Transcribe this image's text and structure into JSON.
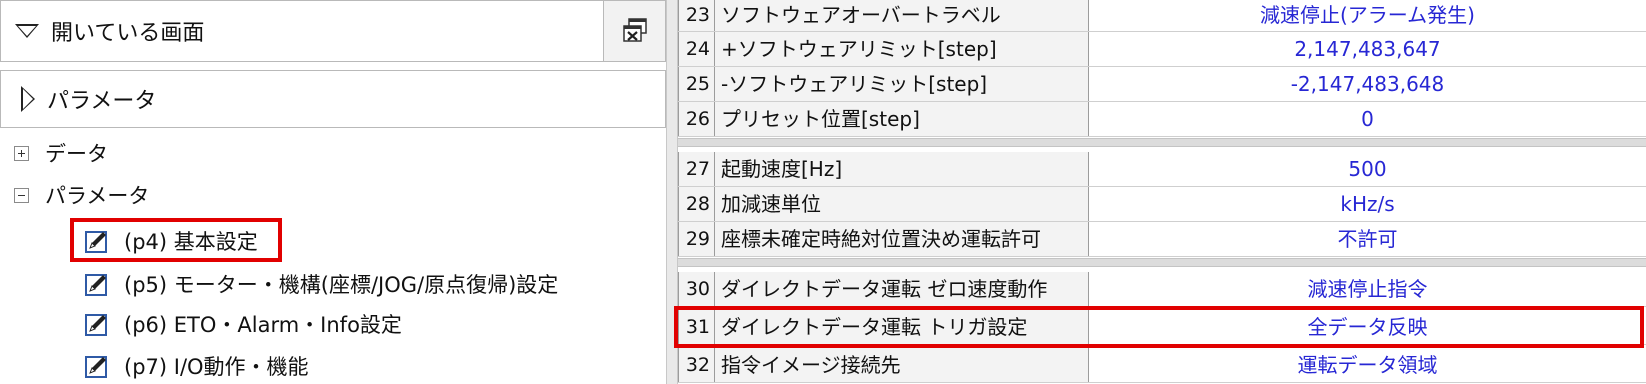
{
  "left_panel": {
    "open_screens_header": "開いている画面",
    "parameter_header": "パラメータ",
    "tree": [
      {
        "label": "データ",
        "expander": "plus"
      },
      {
        "label": "パラメータ",
        "expander": "minus"
      }
    ],
    "children": [
      {
        "label": "(p4) 基本設定",
        "highlighted": true
      },
      {
        "label": "(p5) モーター・機構(座標/JOG/原点復帰)設定",
        "highlighted": false
      },
      {
        "label": "(p6) ETO・Alarm・Info設定",
        "highlighted": false
      },
      {
        "label": "(p7) I/O動作・機能",
        "highlighted": false
      }
    ]
  },
  "parameter_grid": {
    "value_color": "#2727d4",
    "highlight_color": "#e10000",
    "groups": [
      {
        "rows": [
          {
            "no": "23",
            "name": "ソフトウェアオーバートラベル",
            "value": "減速停止(アラーム発生)"
          },
          {
            "no": "24",
            "name": "+ソフトウェアリミット[step]",
            "value": "2,147,483,647"
          },
          {
            "no": "25",
            "name": "-ソフトウェアリミット[step]",
            "value": "-2,147,483,648"
          },
          {
            "no": "26",
            "name": "プリセット位置[step]",
            "value": "0"
          }
        ]
      },
      {
        "rows": [
          {
            "no": "27",
            "name": "起動速度[Hz]",
            "value": "500"
          },
          {
            "no": "28",
            "name": "加減速単位",
            "value": "kHz/s"
          },
          {
            "no": "29",
            "name": "座標未確定時絶対位置決め運転許可",
            "value": "不許可"
          }
        ]
      },
      {
        "rows": [
          {
            "no": "30",
            "name": "ダイレクトデータ運転 ゼロ速度動作",
            "value": "減速停止指令"
          },
          {
            "no": "31",
            "name": "ダイレクトデータ運転 トリガ設定",
            "value": "全データ反映",
            "highlighted": true
          },
          {
            "no": "32",
            "name": "指令イメージ接続先",
            "value": "運転データ領域"
          }
        ]
      }
    ]
  }
}
